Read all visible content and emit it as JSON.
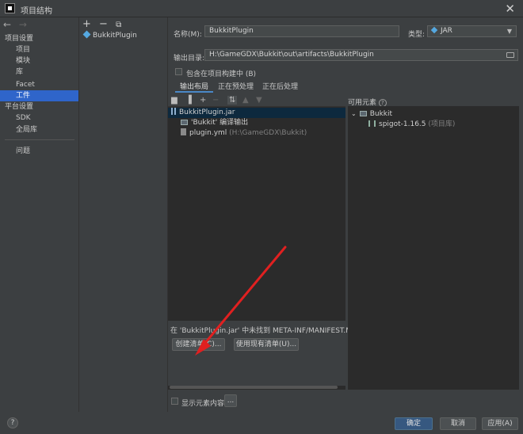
{
  "window": {
    "title": "项目结构",
    "close": "✕"
  },
  "nav": {
    "back": "←",
    "forward": "→"
  },
  "sidebar": {
    "header1": "项目设置",
    "items1": [
      "项目",
      "模块",
      "库",
      "Facet",
      "工件"
    ],
    "header2": "平台设置",
    "items2": [
      "SDK",
      "全局库"
    ],
    "problems": "问题"
  },
  "artifacts": {
    "toolbar": {
      "add": "+",
      "remove": "−",
      "copy": "⧉"
    },
    "items": [
      "BukkitPlugin"
    ]
  },
  "form": {
    "name_label": "名称(M):",
    "name_value": "BukkitPlugin",
    "type_label": "类型:",
    "type_value": "JAR",
    "output_label": "输出目录:",
    "output_value": "H:\\GameGDX\\Bukkit\\out\\artifacts\\BukkitPlugin",
    "include_build": "包含在项目构建中 (B)"
  },
  "tabs": [
    "输出布局",
    "正在预处理",
    "正在后处理"
  ],
  "layout_tree": {
    "jar": "BukkitPlugin.jar",
    "compile_output": "'Bukkit' 编译输出",
    "plugin_file": "plugin.yml",
    "plugin_path": "(H:\\GameGDX\\Bukkit)"
  },
  "manifest": {
    "message": "在 'BukkitPlugin.jar' 中未找到 META-INF/MANIFEST.MF 文件",
    "create_button": "创建清单(C)...",
    "use_existing_button": "使用现有清单(U)..."
  },
  "available": {
    "label": "可用元素",
    "module": "Bukkit",
    "library": "spigot-1.16.5",
    "library_note": "(项目库)"
  },
  "footer": {
    "show_content": "显示元素内容",
    "ellipsis": "...",
    "ok": "确定",
    "cancel": "取消",
    "apply": "应用(A)",
    "help": "?"
  },
  "colors": {
    "selection": "#2f65ca",
    "annotation_arrow": "#e02020"
  }
}
